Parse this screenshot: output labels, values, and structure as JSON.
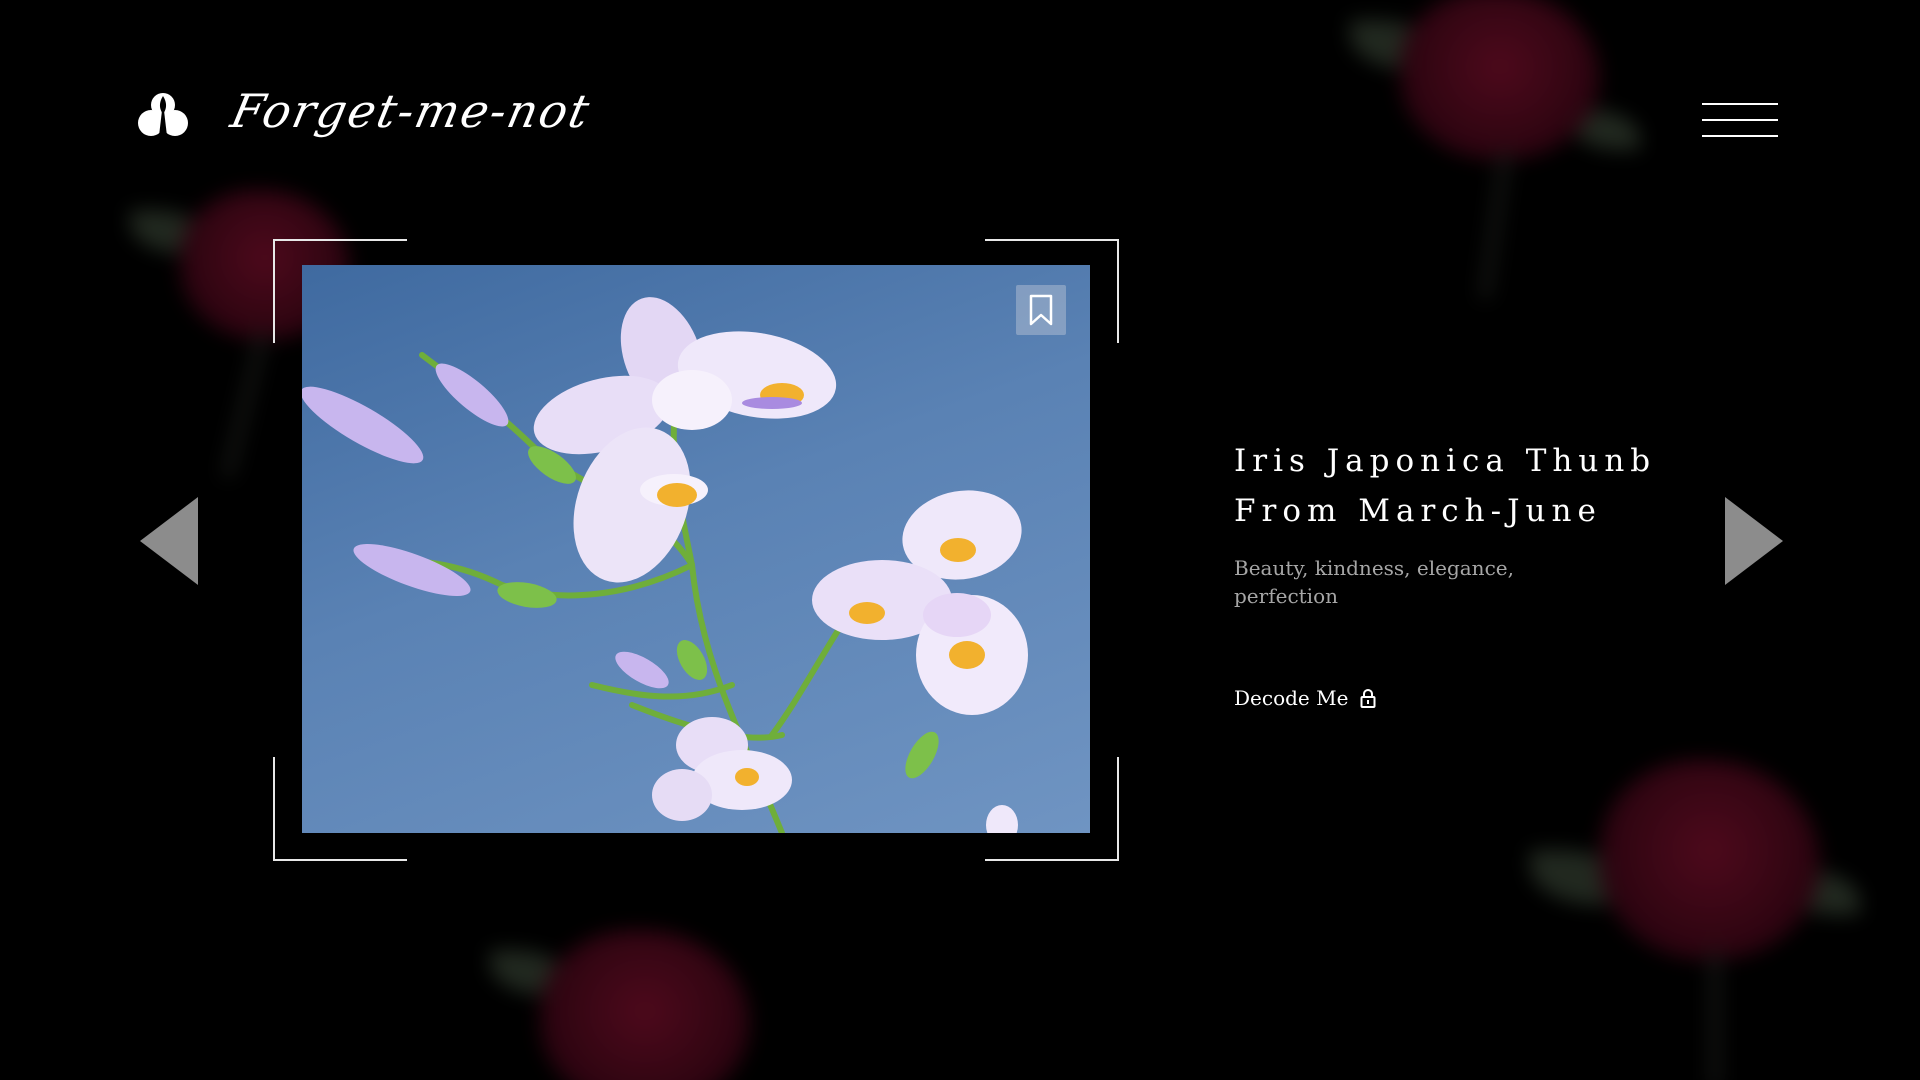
{
  "brand": {
    "name": "Forget-me-not",
    "logo_icon": "flower-bud-icon"
  },
  "header": {
    "menu_icon": "hamburger-menu-icon"
  },
  "gallery": {
    "image_subject": "iris-flower-photo",
    "bookmark_icon": "bookmark-icon",
    "prev_icon": "triangle-left-icon",
    "next_icon": "triangle-right-icon"
  },
  "flower": {
    "title_line1": "Iris Japonica Thunb",
    "title_line2": "From March-June",
    "meaning": "Beauty, kindness, elegance, perfection",
    "decode_label": "Decode Me",
    "decode_icon": "lock-icon"
  },
  "colors": {
    "background": "#000000",
    "text": "#ffffff",
    "muted_text": "#a6a6a6",
    "arrow": "#8c8c8c",
    "rose": "#8e1234"
  }
}
